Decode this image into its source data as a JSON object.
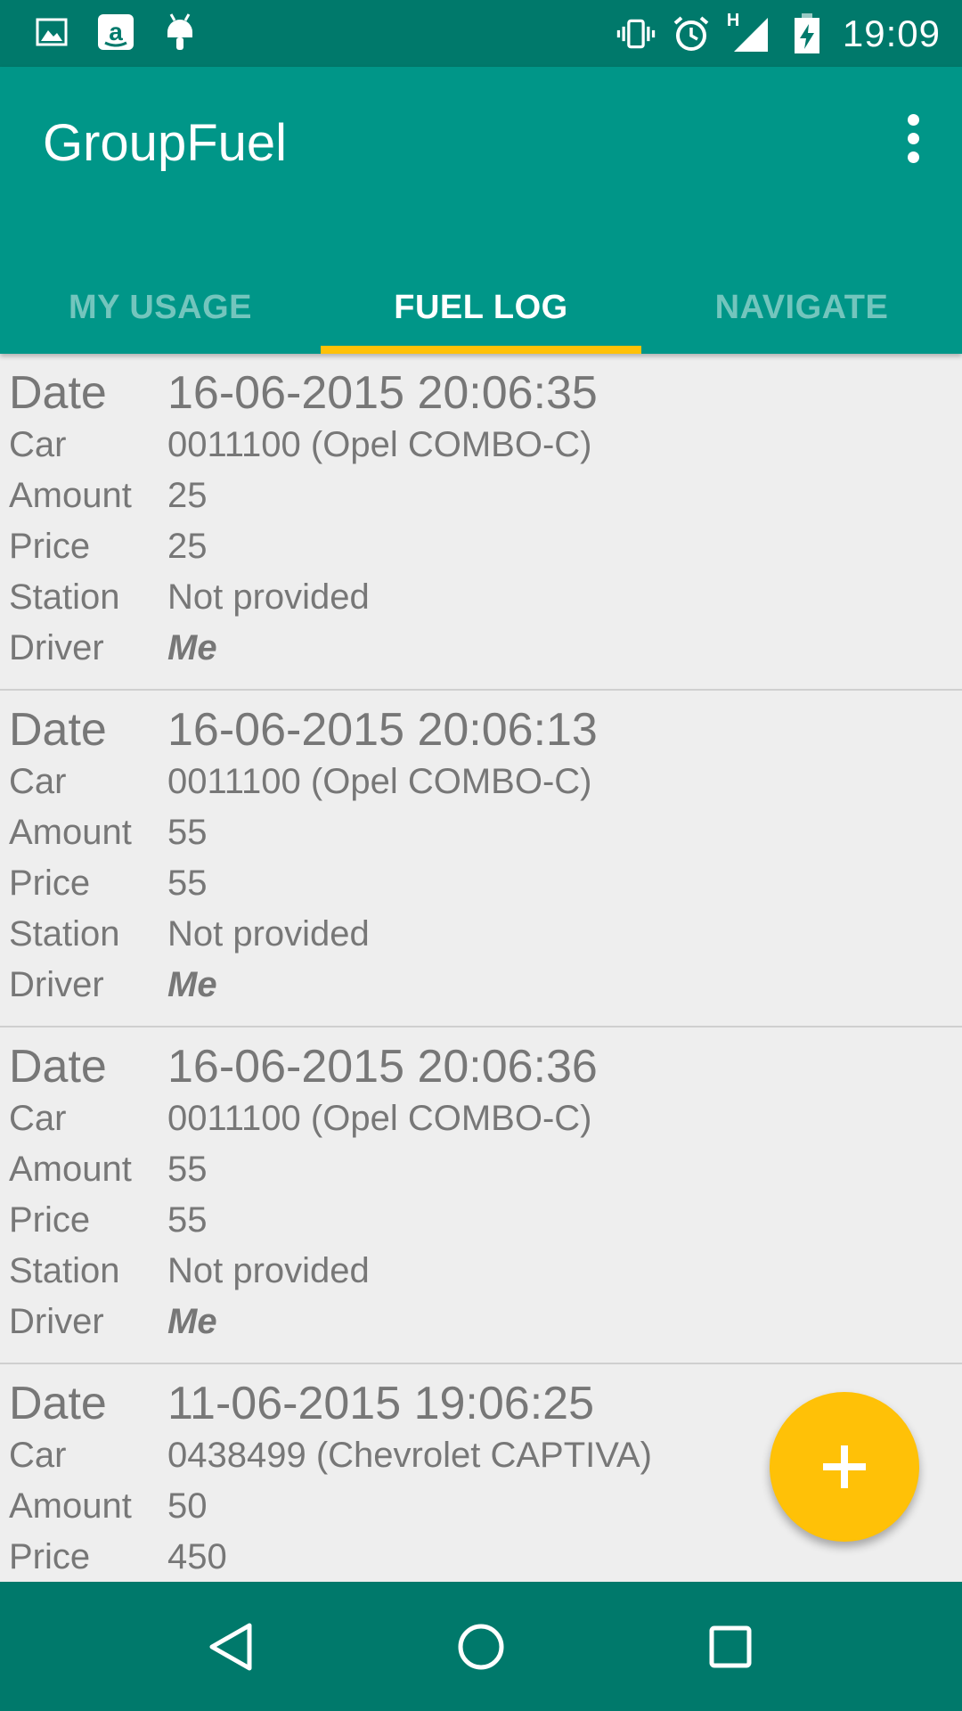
{
  "status_bar": {
    "time": "19:09",
    "network_label": "H",
    "icons": [
      "image-icon",
      "amazon-icon",
      "android-icon",
      "vibrate-icon",
      "alarm-icon",
      "signal-icon",
      "battery-charging-icon"
    ]
  },
  "app": {
    "title": "GroupFuel",
    "overflow_icon": "more-vert-icon"
  },
  "tabs": [
    {
      "label": "MY USAGE",
      "active": false
    },
    {
      "label": "FUEL LOG",
      "active": true
    },
    {
      "label": "NAVIGATE",
      "active": false
    }
  ],
  "labels": {
    "date": "Date",
    "car": "Car",
    "amount": "Amount",
    "price": "Price",
    "station": "Station",
    "driver": "Driver"
  },
  "entries": [
    {
      "date": "16-06-2015 20:06:35",
      "car": "0011100 (Opel COMBO-C)",
      "amount": "25",
      "price": "25",
      "station": "Not provided",
      "driver": "Me"
    },
    {
      "date": "16-06-2015 20:06:13",
      "car": "0011100 (Opel COMBO-C)",
      "amount": "55",
      "price": "55",
      "station": "Not provided",
      "driver": "Me"
    },
    {
      "date": "16-06-2015 20:06:36",
      "car": "0011100 (Opel COMBO-C)",
      "amount": "55",
      "price": "55",
      "station": "Not provided",
      "driver": "Me"
    },
    {
      "date": "11-06-2015 19:06:25",
      "car": "0438499 (Chevrolet CAPTIVA)",
      "amount": "50",
      "price": "450"
    }
  ],
  "fab": {
    "icon": "plus-icon"
  },
  "nav": {
    "icons": [
      "back-icon",
      "home-icon",
      "recents-icon"
    ]
  },
  "colors": {
    "status_bar": "#00796b",
    "primary": "#009688",
    "accent": "#ffc107",
    "background": "#eeeeee",
    "text": "#777777"
  }
}
